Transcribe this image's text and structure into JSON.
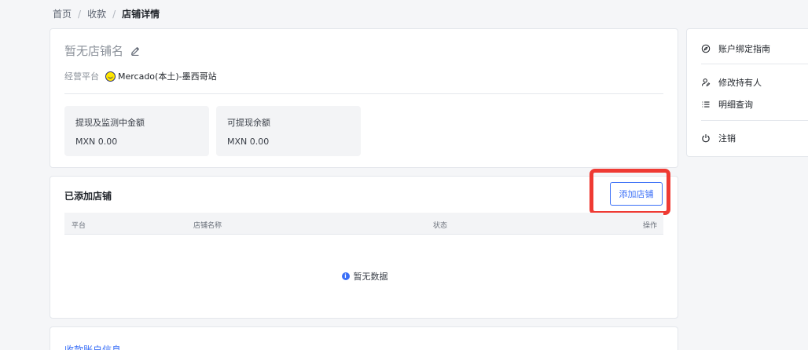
{
  "breadcrumb": {
    "items": [
      "首页",
      "收款",
      "店铺详情"
    ],
    "separator": "/"
  },
  "store": {
    "name": "暂无店铺名",
    "platform_label": "经营平台",
    "platform_value": "Mercado(本土)-墨西哥站",
    "platform_icon": "mercado-libre-logo-icon",
    "stats": [
      {
        "title": "提现及监测中金额",
        "amount": "MXN 0.00"
      },
      {
        "title": "可提现余额",
        "amount": "MXN 0.00"
      }
    ]
  },
  "shops": {
    "title": "已添加店铺",
    "add_button": "添加店铺",
    "columns": [
      "平台",
      "店铺名称",
      "状态",
      "操作"
    ],
    "rows": [],
    "empty_text": "暂无数据"
  },
  "account_info": {
    "title": "收款账户信息"
  },
  "side_menu": {
    "items": [
      {
        "label": "账户绑定指南",
        "icon": "compass-icon"
      },
      {
        "label": "修改持有人",
        "icon": "user-edit-icon"
      },
      {
        "label": "明细查询",
        "icon": "list-icon"
      },
      {
        "label": "注销",
        "icon": "power-icon"
      }
    ]
  },
  "colors": {
    "accent": "#3a6ff7",
    "highlight": "#ef3a33",
    "background": "#f5f6f8"
  }
}
